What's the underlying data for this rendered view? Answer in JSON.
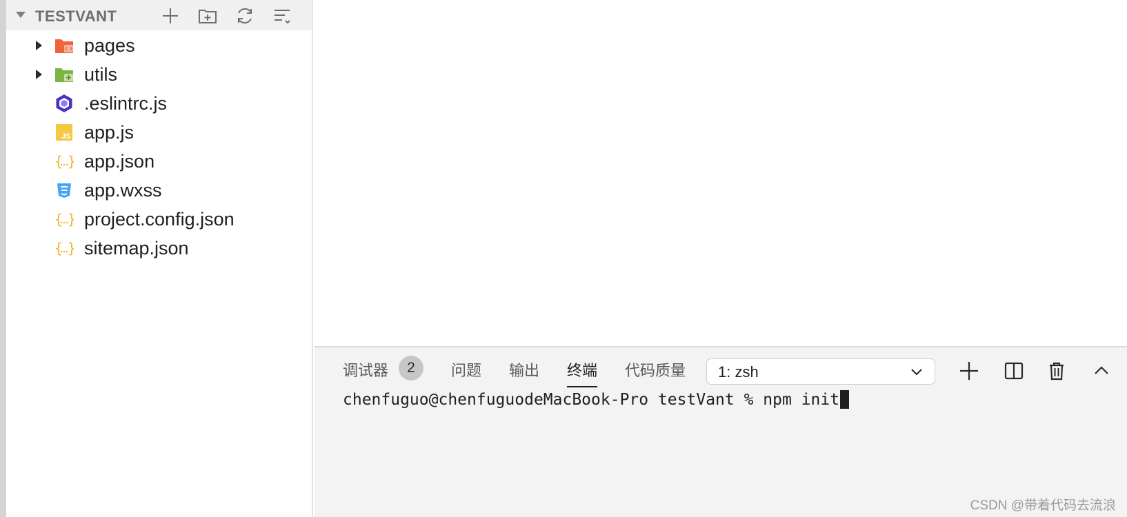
{
  "sidebar": {
    "project_title": "TESTVANT",
    "header_icons": [
      "new-file-icon",
      "new-folder-icon",
      "refresh-icon",
      "collapse-all-icon"
    ],
    "files": [
      {
        "name": "pages",
        "type": "folder",
        "icon": "folder-pages-icon",
        "color": "#f0643c"
      },
      {
        "name": "utils",
        "type": "folder",
        "icon": "folder-utils-icon",
        "color": "#7cb342"
      },
      {
        "name": ".eslintrc.js",
        "type": "file",
        "icon": "eslint-icon",
        "color": "#4b32c3"
      },
      {
        "name": "app.js",
        "type": "file",
        "icon": "js-icon",
        "color": "#f5c842"
      },
      {
        "name": "app.json",
        "type": "file",
        "icon": "json-icon",
        "color": "#f5c842"
      },
      {
        "name": "app.wxss",
        "type": "file",
        "icon": "css-icon",
        "color": "#42a5f5"
      },
      {
        "name": "project.config.json",
        "type": "file",
        "icon": "json-icon",
        "color": "#f5c842"
      },
      {
        "name": "sitemap.json",
        "type": "file",
        "icon": "json-icon",
        "color": "#f5c842"
      }
    ]
  },
  "panel": {
    "tabs": [
      {
        "label": "调试器"
      },
      {
        "label": "问题"
      },
      {
        "label": "输出"
      },
      {
        "label": "终端",
        "active": true
      },
      {
        "label": "代码质量"
      }
    ],
    "debugger_badge": "2",
    "terminal_select": "1: zsh",
    "toolbar_icons": [
      "add-terminal-icon",
      "split-terminal-icon",
      "trash-icon",
      "chevron-up-icon"
    ],
    "terminal": {
      "prompt": "chenfuguo@chenfuguodeMacBook-Pro testVant % ",
      "command": "npm init"
    }
  },
  "watermark": "CSDN @带着代码去流浪"
}
